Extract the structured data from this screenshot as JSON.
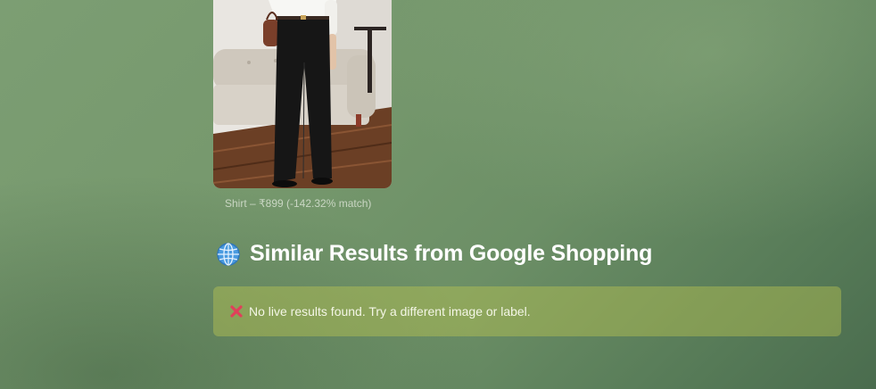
{
  "product": {
    "caption": "Shirt – ₹899 (-142.32% match)"
  },
  "similar_section": {
    "icon": "globe-icon",
    "title": "Similar Results from Google Shopping"
  },
  "alert": {
    "icon": "cross-icon",
    "message": "No live results found. Try a different image or label.",
    "color_accent": "#e0405a"
  }
}
